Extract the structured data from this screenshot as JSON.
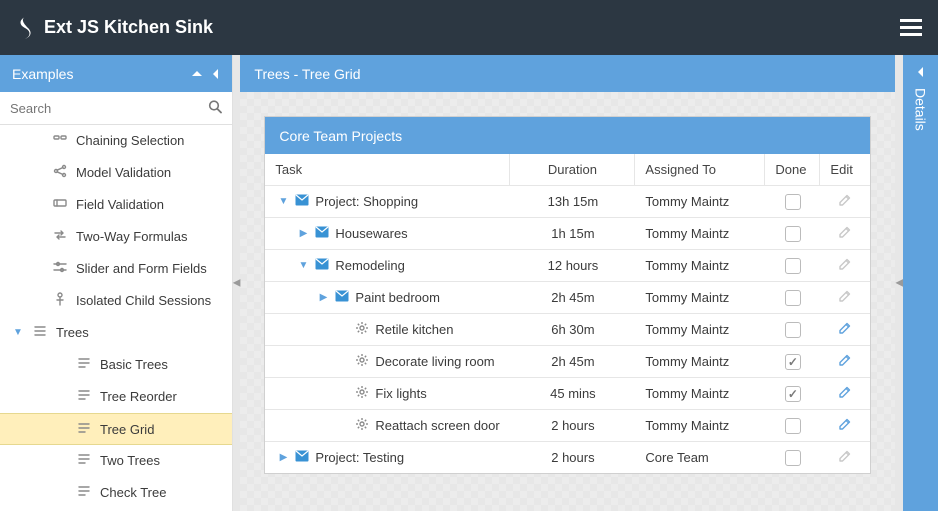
{
  "app": {
    "title": "Ext JS Kitchen Sink"
  },
  "sidebar": {
    "title": "Examples",
    "search_placeholder": "Search",
    "items": [
      {
        "label": "Chaining Selection",
        "depth": 1,
        "glyph": "link",
        "selected": false,
        "expanded": null
      },
      {
        "label": "Model Validation",
        "depth": 1,
        "glyph": "share",
        "selected": false,
        "expanded": null
      },
      {
        "label": "Field Validation",
        "depth": 1,
        "glyph": "field",
        "selected": false,
        "expanded": null
      },
      {
        "label": "Two-Way Formulas",
        "depth": 1,
        "glyph": "swap",
        "selected": false,
        "expanded": null
      },
      {
        "label": "Slider and Form Fields",
        "depth": 1,
        "glyph": "slider",
        "selected": false,
        "expanded": null
      },
      {
        "label": "Isolated Child Sessions",
        "depth": 1,
        "glyph": "child",
        "selected": false,
        "expanded": null
      },
      {
        "label": "Trees",
        "depth": 0,
        "glyph": "folder",
        "selected": false,
        "expanded": true
      },
      {
        "label": "Basic Trees",
        "depth": 2,
        "glyph": "leaf",
        "selected": false,
        "expanded": null
      },
      {
        "label": "Tree Reorder",
        "depth": 2,
        "glyph": "leaf",
        "selected": false,
        "expanded": null
      },
      {
        "label": "Tree Grid",
        "depth": 2,
        "glyph": "leaf",
        "selected": true,
        "expanded": null
      },
      {
        "label": "Two Trees",
        "depth": 2,
        "glyph": "leaf",
        "selected": false,
        "expanded": null
      },
      {
        "label": "Check Tree",
        "depth": 2,
        "glyph": "leaf",
        "selected": false,
        "expanded": null
      }
    ]
  },
  "main": {
    "title": "Trees - Tree Grid",
    "panel_title": "Core Team Projects",
    "columns": {
      "task": "Task",
      "duration": "Duration",
      "assigned": "Assigned To",
      "done": "Done",
      "edit": "Edit"
    },
    "rows": [
      {
        "indent": 0,
        "caret": "down",
        "type": "folder",
        "task": "Project: Shopping",
        "duration": "13h 15m",
        "assigned": "Tommy Maintz",
        "done": false,
        "edit_active": false
      },
      {
        "indent": 1,
        "caret": "right",
        "type": "folder",
        "task": "Housewares",
        "duration": "1h 15m",
        "assigned": "Tommy Maintz",
        "done": false,
        "edit_active": false
      },
      {
        "indent": 1,
        "caret": "down",
        "type": "folder",
        "task": "Remodeling",
        "duration": "12 hours",
        "assigned": "Tommy Maintz",
        "done": false,
        "edit_active": false
      },
      {
        "indent": 2,
        "caret": "right",
        "type": "folder",
        "task": "Paint bedroom",
        "duration": "2h 45m",
        "assigned": "Tommy Maintz",
        "done": false,
        "edit_active": false
      },
      {
        "indent": 3,
        "caret": "none",
        "type": "leaf",
        "task": "Retile kitchen",
        "duration": "6h 30m",
        "assigned": "Tommy Maintz",
        "done": false,
        "edit_active": true
      },
      {
        "indent": 3,
        "caret": "none",
        "type": "leaf",
        "task": "Decorate living room",
        "duration": "2h 45m",
        "assigned": "Tommy Maintz",
        "done": true,
        "edit_active": true
      },
      {
        "indent": 3,
        "caret": "none",
        "type": "leaf",
        "task": "Fix lights",
        "duration": "45 mins",
        "assigned": "Tommy Maintz",
        "done": true,
        "edit_active": true
      },
      {
        "indent": 3,
        "caret": "none",
        "type": "leaf",
        "task": "Reattach screen door",
        "duration": "2 hours",
        "assigned": "Tommy Maintz",
        "done": false,
        "edit_active": true
      },
      {
        "indent": 0,
        "caret": "right",
        "type": "folder",
        "task": "Project: Testing",
        "duration": "2 hours",
        "assigned": "Core Team",
        "done": false,
        "edit_active": false
      }
    ]
  },
  "details": {
    "title": "Details"
  }
}
